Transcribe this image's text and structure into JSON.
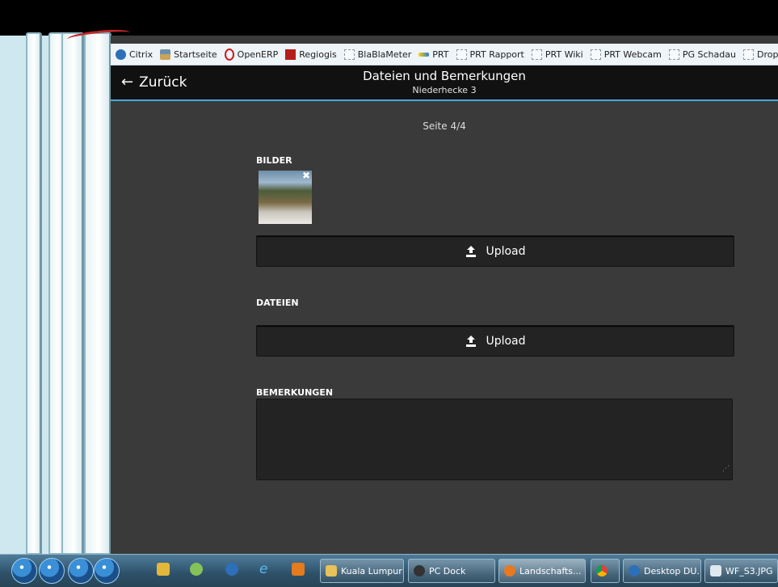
{
  "bookmarks": [
    {
      "label": "Citrix",
      "icon": "citrix-icon"
    },
    {
      "label": "Startseite",
      "icon": "home-user-icon"
    },
    {
      "label": "OpenERP",
      "icon": "opera-icon"
    },
    {
      "label": "Regiogis",
      "icon": "red-mountain-icon"
    },
    {
      "label": "BlaBlaMeter",
      "icon": "bookmark-empty-icon"
    },
    {
      "label": "PRT",
      "icon": "flag-line-icon"
    },
    {
      "label": "PRT Rapport",
      "icon": "bookmark-empty-icon"
    },
    {
      "label": "PRT Wiki",
      "icon": "bookmark-empty-icon"
    },
    {
      "label": "PRT Webcam",
      "icon": "bookmark-empty-icon"
    },
    {
      "label": "PG Schadau",
      "icon": "bookmark-empty-icon"
    },
    {
      "label": "Dropl",
      "icon": "bookmark-empty-icon"
    }
  ],
  "nav": {
    "back_label": "Zurück",
    "title": "Dateien und Bemerkungen",
    "subtitle": "Niederhecke 3"
  },
  "form": {
    "page_indicator": "Seite 4/4",
    "images_label": "BILDER",
    "upload_label": "Upload",
    "files_label": "DATEIEN",
    "files_upload_label": "Upload",
    "remarks_label": "BEMERKUNGEN",
    "remarks_value": ""
  },
  "taskbar": {
    "buttons": [
      {
        "label": "Kuala Lumpur",
        "icon": "folder-icon"
      },
      {
        "label": "PC Dock",
        "icon": "pc-dock-icon"
      },
      {
        "label": "Landschafts...",
        "icon": "firefox-icon"
      },
      {
        "label": "",
        "icon": "chrome-icon"
      },
      {
        "label": "Desktop DU...",
        "icon": "citrix-icon"
      },
      {
        "label": "WF_S3.JPG",
        "icon": "image-viewer-icon"
      }
    ]
  },
  "colors": {
    "accent": "#46a8d8",
    "panel_bg": "#3a3a3a",
    "header_bg": "#111111",
    "button_bg": "#232323"
  }
}
